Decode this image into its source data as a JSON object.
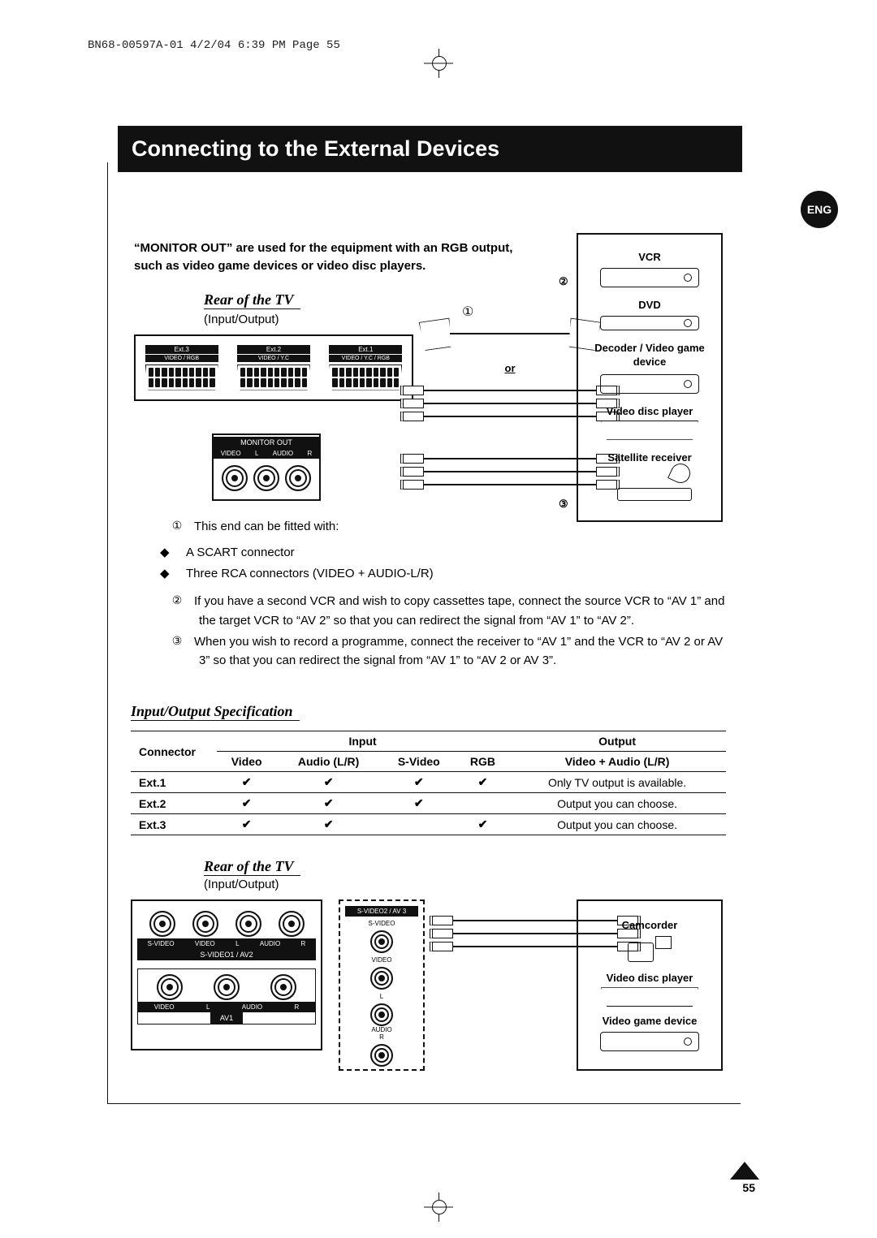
{
  "header_line": "BN68-00597A-01  4/2/04  6:39 PM  Page 55",
  "language_badge": "ENG",
  "title": "Connecting to the External Devices",
  "intro": "“MONITOR OUT” are used for the equipment with an RGB output, such as video game devices or video disc players.",
  "rear_label": "Rear of the TV",
  "io_label": "(Input/Output)",
  "or_label": "or",
  "scart_ports": [
    {
      "top": "Ext.3",
      "bottom": "VIDEO / RGB"
    },
    {
      "top": "Ext.2",
      "bottom": "VIDEO / Y.C"
    },
    {
      "top": "Ext.1",
      "bottom": "VIDEO / Y.C / RGB"
    }
  ],
  "monitor_out": {
    "title": "MONITOR OUT",
    "labels": [
      "VIDEO",
      "L",
      "AUDIO",
      "R"
    ]
  },
  "devices_top": {
    "vcr": "VCR",
    "dvd": "DVD",
    "decoder": "Decoder / Video game device",
    "disc": "Video disc player",
    "satellite": "Satellite receiver"
  },
  "marker_chars": {
    "one": "①",
    "two": "②",
    "three": "③"
  },
  "notes": {
    "n1_lead": "This end can be fitted with:",
    "n1_a": "A SCART connector",
    "n1_b": "Three RCA connectors (VIDEO + AUDIO-L/R)",
    "n2": "If you have a second VCR and wish to copy cassettes tape, connect the source VCR to “AV 1” and the target VCR to “AV 2” so that you can redirect the signal from “AV 1” to “AV 2”.",
    "n3": "When you wish to record a programme, connect the receiver to “AV 1” and the VCR to “AV 2 or AV 3” so that you can redirect the signal from “AV 1” to “AV 2 or AV 3”."
  },
  "spec_heading": "Input/Output Specification",
  "table": {
    "connector": "Connector",
    "input": "Input",
    "output": "Output",
    "cols": [
      "Video",
      "Audio (L/R)",
      "S-Video",
      "RGB"
    ],
    "out_col": "Video + Audio (L/R)",
    "rows": [
      {
        "name": "Ext.1",
        "vals": [
          true,
          true,
          true,
          true
        ],
        "out": "Only TV output is available."
      },
      {
        "name": "Ext.2",
        "vals": [
          true,
          true,
          true,
          false
        ],
        "out": "Output you can choose."
      },
      {
        "name": "Ext.3",
        "vals": [
          true,
          true,
          false,
          true
        ],
        "out": "Output you can choose."
      }
    ]
  },
  "side_panel1": {
    "row1_labels": [
      "S-VIDEO",
      "VIDEO",
      "L",
      "AUDIO",
      "R"
    ],
    "title1": "S-VIDEO1 / AV2",
    "row2_labels": [
      "VIDEO",
      "L",
      "AUDIO",
      "R"
    ],
    "title2": "AV1"
  },
  "side_panel2": {
    "top": "S-VIDEO2 / AV 3",
    "items": [
      "S-VIDEO",
      "VIDEO",
      "L",
      "AUDIO",
      "R"
    ]
  },
  "devices_bottom": {
    "camcorder": "Camcorder",
    "disc": "Video disc player",
    "game": "Video game device"
  },
  "page_number": "55"
}
